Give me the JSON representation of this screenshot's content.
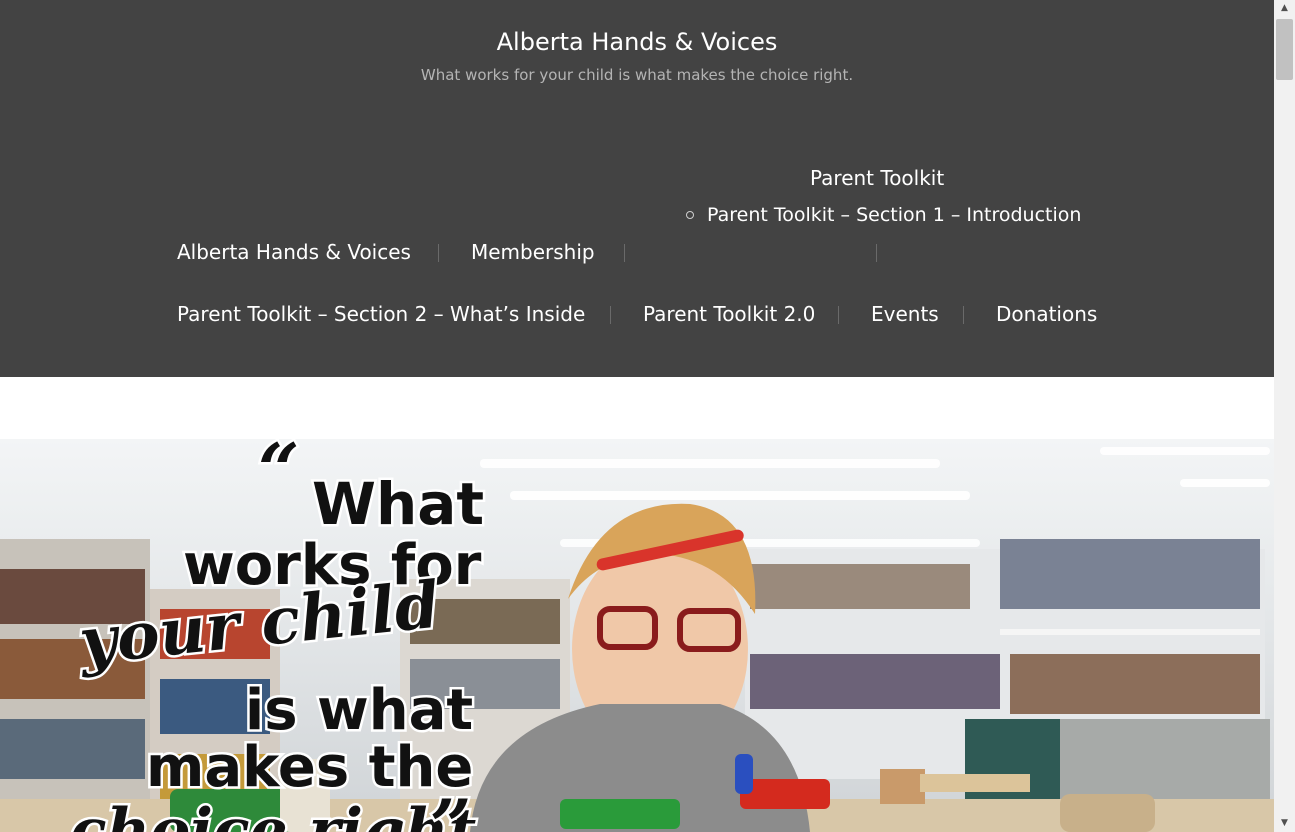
{
  "site": {
    "title": "Alberta Hands & Voices",
    "tagline": "What works for your child is what makes the choice right."
  },
  "nav": {
    "parent_toolkit": "Parent Toolkit",
    "section1": "Parent Toolkit – Section 1 – Introduction",
    "home": "Alberta Hands & Voices",
    "membership": "Membership",
    "section2": "Parent Toolkit – Section 2 – What’s Inside",
    "toolkit2": "Parent Toolkit 2.0",
    "events": "Events",
    "donations": "Donations"
  },
  "hero": {
    "open_quote": "“",
    "line1": "What",
    "line2": "works for",
    "line3": "your child",
    "line4": "is what",
    "line5": "makes the",
    "line6": "choice right",
    "close_quote": "”"
  },
  "colors": {
    "header_bg": "#434343",
    "nav_text": "#ffffff",
    "tagline": "#b4b4b4"
  },
  "icons": {
    "submenu_bullet": "hollow-circle",
    "scroll_up": "triangle-up",
    "scroll_down": "triangle-down"
  }
}
